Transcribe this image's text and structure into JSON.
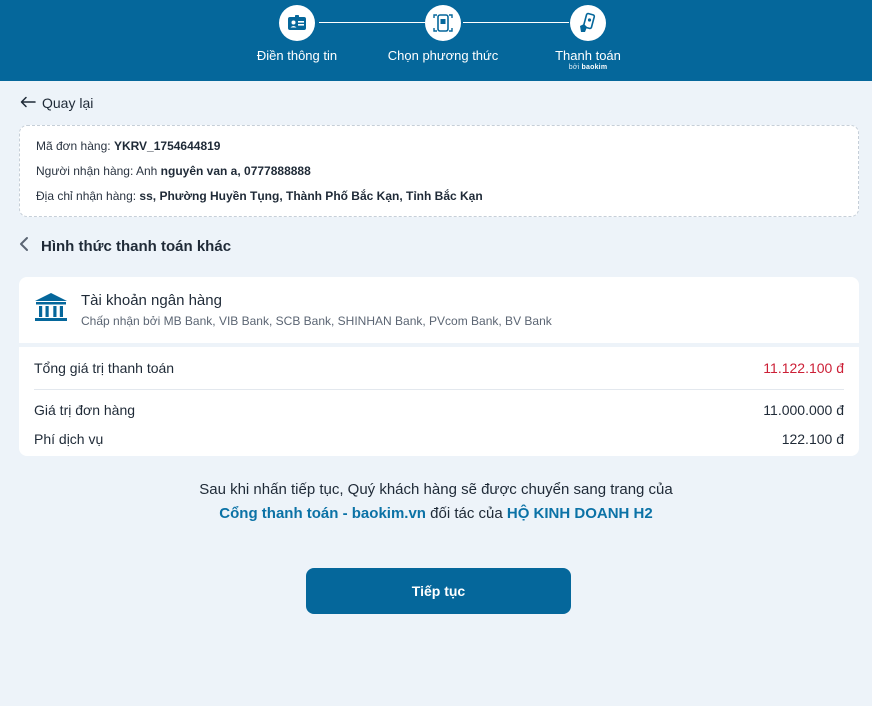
{
  "stepper": {
    "steps": [
      {
        "label": "Điền thông tin",
        "icon": "id-card-icon"
      },
      {
        "label": "Chọn phương thức",
        "icon": "payment-method-icon"
      },
      {
        "label": "Thanh toán",
        "icon": "phone-payment-icon",
        "sublabel_prefix": "bởi",
        "sublabel_brand": "baokim"
      }
    ]
  },
  "back": {
    "label": "Quay lại"
  },
  "order": {
    "code_label": "Mã đơn hàng:",
    "code_value": "YKRV_1754644819",
    "receiver_label": "Người nhận hàng: Anh",
    "receiver_value": "nguyên van a, 0777888888",
    "address_label": "Địa chỉ nhận hàng:",
    "address_value": "ss, Phường Huyền Tụng, Thành Phố Bắc Kạn, Tỉnh Bắc Kạn"
  },
  "section": {
    "title": "Hình thức thanh toán khác"
  },
  "bank": {
    "title": "Tài khoản ngân hàng",
    "desc": "Chấp nhận bởi MB Bank, VIB Bank, SCB Bank, SHINHAN Bank, PVcom Bank, BV Bank"
  },
  "summary": {
    "total_label": "Tổng giá trị thanh toán",
    "total_value": "11.122.100 đ",
    "order_label": "Giá trị đơn hàng",
    "order_value": "11.000.000 đ",
    "fee_label": "Phí dịch vụ",
    "fee_value": "122.100 đ"
  },
  "note": {
    "line1": "Sau khi nhấn tiếp tục, Quý khách hàng sẽ được chuyển sang trang của",
    "gateway": "Cổng thanh toán - baokim.vn",
    "middle": " đối tác của ",
    "merchant": "HỘ KINH DOANH H2"
  },
  "continue": {
    "label": "Tiếp tục"
  },
  "colors": {
    "primary": "#05679b",
    "background": "#edf3f9",
    "total_red": "#cc1f36",
    "accent_link": "#0b72a6"
  }
}
